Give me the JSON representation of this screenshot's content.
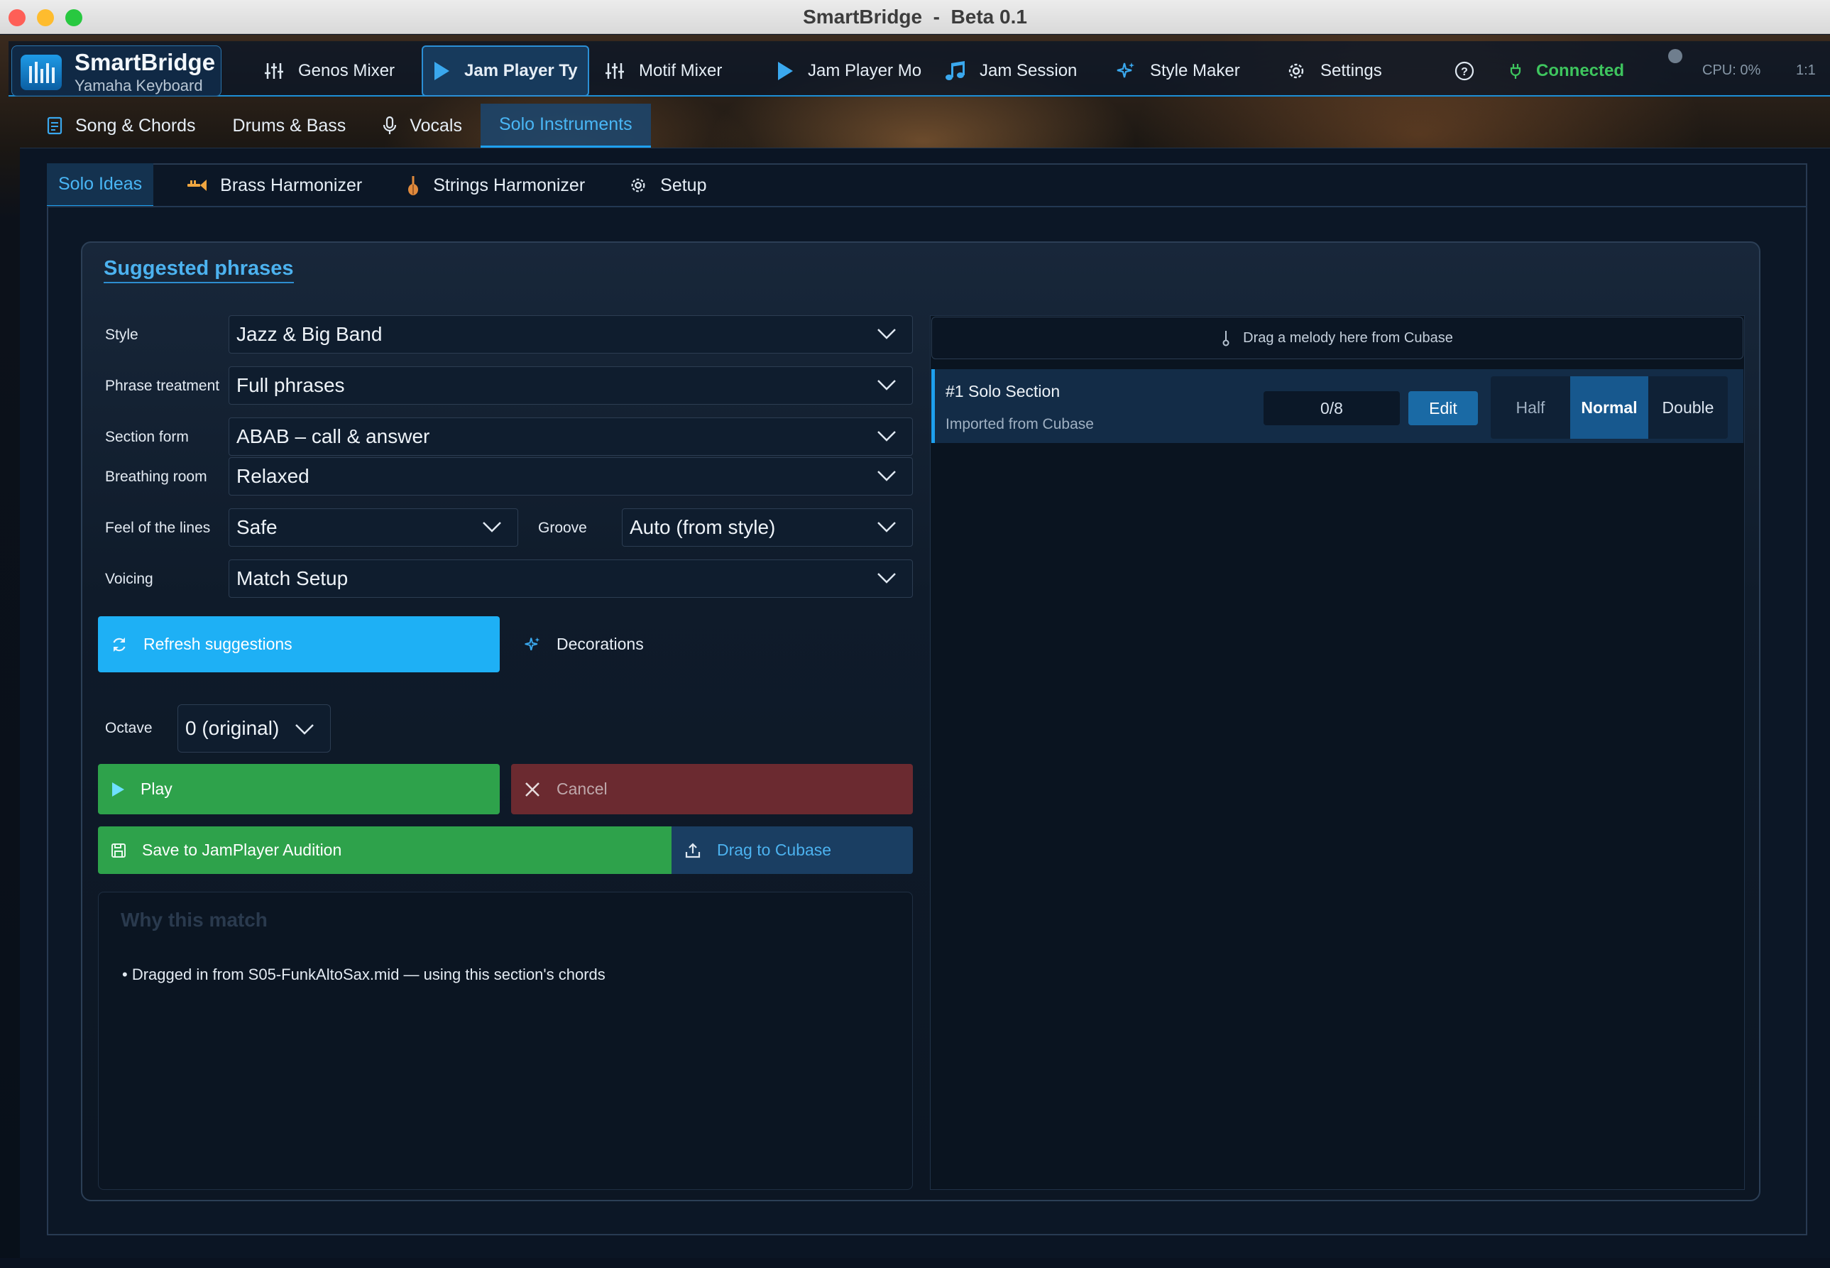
{
  "window": {
    "title": "SmartBridge  -  Beta 0.1"
  },
  "brand": {
    "name": "SmartBridge",
    "subtitle": "Yamaha Keyboard"
  },
  "topnav": {
    "items": [
      {
        "label": "Genos Mixer",
        "icon": "sliders-icon"
      },
      {
        "label": "Jam Player Ty",
        "icon": "play-icon",
        "active": true
      },
      {
        "label": "Motif Mixer",
        "icon": "sliders-icon"
      },
      {
        "label": "Jam Player Mo",
        "icon": "play-icon"
      },
      {
        "label": "Jam Session",
        "icon": "music-note-icon"
      },
      {
        "label": "Style Maker",
        "icon": "sparkle-icon"
      },
      {
        "label": "Settings",
        "icon": "gear-icon"
      }
    ],
    "status": {
      "label": "Connected",
      "color": "#3ec55e"
    },
    "cpu": "CPU: 0%",
    "ratio": "1:1"
  },
  "subnav": {
    "items": [
      {
        "label": "Song & Chords",
        "icon": "document-icon"
      },
      {
        "label": "Drums & Bass"
      },
      {
        "label": "Vocals",
        "icon": "microphone-icon"
      },
      {
        "label": "Solo Instruments",
        "active": true
      }
    ]
  },
  "tabs": [
    {
      "label": "Solo Ideas",
      "active": true
    },
    {
      "label": "Brass Harmonizer",
      "icon": "trumpet-icon"
    },
    {
      "label": "Strings Harmonizer",
      "icon": "violin-icon"
    },
    {
      "label": "Setup",
      "icon": "gear-icon"
    }
  ],
  "card": {
    "title": "Suggested phrases"
  },
  "form": {
    "style": {
      "label": "Style",
      "value": "Jazz & Big Band"
    },
    "phrase_treatment": {
      "label": "Phrase treatment",
      "value": "Full phrases"
    },
    "section_form": {
      "label": "Section form",
      "value": "ABAB – call & answer"
    },
    "breathing_room": {
      "label": "Breathing room",
      "value": "Relaxed"
    },
    "feel": {
      "label": "Feel of the lines",
      "value": "Safe"
    },
    "groove": {
      "label": "Groove",
      "value": "Auto (from style)"
    },
    "voicing": {
      "label": "Voicing",
      "value": "Match Setup"
    },
    "octave": {
      "label": "Octave",
      "value": "0 (original)"
    }
  },
  "buttons": {
    "refresh": "Refresh suggestions",
    "decorations": "Decorations",
    "play": "Play",
    "cancel": "Cancel",
    "save": "Save to JamPlayer Audition",
    "drag": "Drag to Cubase"
  },
  "why": {
    "title": "Why this match",
    "items": [
      "• Dragged in from S05-FunkAltoSax.mid — using this section's chords"
    ]
  },
  "right": {
    "dropzone": "Drag a melody here from Cubase",
    "section": {
      "title": "#1 Solo Section",
      "subtitle": "Imported from Cubase",
      "counter": "0/8",
      "edit": "Edit",
      "speed": {
        "options": [
          "Half",
          "Normal",
          "Double"
        ],
        "selected": "Normal"
      }
    }
  },
  "colors": {
    "accent": "#1ea0ee",
    "play": "#2ea24b",
    "cancel": "#6b2a30"
  }
}
